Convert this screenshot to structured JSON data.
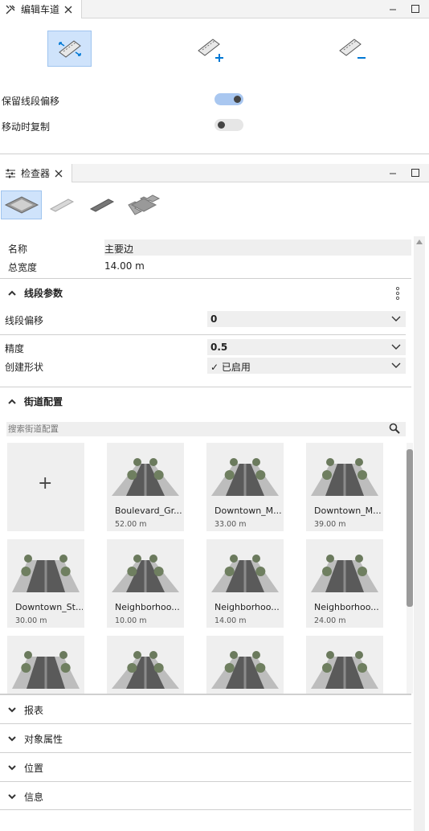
{
  "edit_panel": {
    "tab_label": "编辑车道",
    "tools": [
      "edit-lane-icon",
      "add-lane-icon",
      "remove-lane-icon"
    ],
    "keep_offset_label": "保留线段偏移",
    "keep_offset_on": true,
    "copy_on_move_label": "移动时复制",
    "copy_on_move_on": false
  },
  "inspector": {
    "tab_label": "检查器",
    "filter_icons": [
      "street-block-icon",
      "segment-icon",
      "edge-icon",
      "intersection-icon"
    ],
    "name_label": "名称",
    "name_value": "主要边",
    "width_label": "总宽度",
    "width_value": "14.00 m",
    "segment_section": {
      "title": "线段参数",
      "offset_label": "线段偏移",
      "offset_value": "0",
      "precision_label": "精度",
      "precision_value": "0.5",
      "shape_label": "创建形状",
      "shape_value": "✓ 已启用"
    },
    "street_config": {
      "title": "街道配置",
      "search_placeholder": "搜索街道配置",
      "add_symbol": "+",
      "cards": [
        {
          "name": "Boulevard_Gr...",
          "size": "52.00 m"
        },
        {
          "name": "Downtown_M...",
          "size": "33.00 m"
        },
        {
          "name": "Downtown_M...",
          "size": "39.00 m"
        },
        {
          "name": "Downtown_St...",
          "size": "30.00 m"
        },
        {
          "name": "Neighborhoo...",
          "size": "10.00 m"
        },
        {
          "name": "Neighborhoo...",
          "size": "14.00 m"
        },
        {
          "name": "Neighborhoo...",
          "size": "24.00 m"
        },
        {
          "name": "",
          "size": ""
        },
        {
          "name": "",
          "size": ""
        },
        {
          "name": "",
          "size": ""
        },
        {
          "name": "",
          "size": ""
        }
      ]
    },
    "collapsed_sections": [
      "报表",
      "对象属性",
      "位置",
      "信息"
    ]
  },
  "colors": {
    "accent": "#0078d4",
    "toggle_on": "#a9c7f0",
    "selected_bg": "#cfe3fb"
  }
}
